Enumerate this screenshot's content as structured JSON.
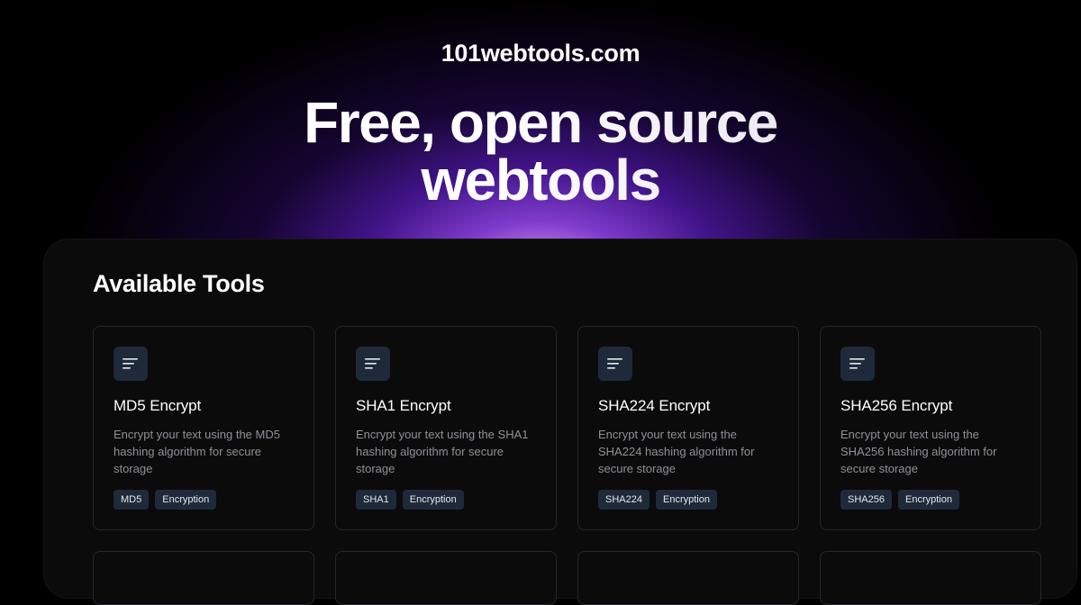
{
  "site": {
    "name": "101webtools.com"
  },
  "hero": {
    "headline_line1": "Free, open source",
    "headline_line2": "webtools"
  },
  "panel": {
    "title": "Available Tools"
  },
  "tools": [
    {
      "title": "MD5 Encrypt",
      "description": "Encrypt your text using the MD5 hashing algorithm for secure storage",
      "tags": [
        "MD5",
        "Encryption"
      ],
      "icon": "text-lines-icon"
    },
    {
      "title": "SHA1 Encrypt",
      "description": "Encrypt your text using the SHA1 hashing algorithm for secure storage",
      "tags": [
        "SHA1",
        "Encryption"
      ],
      "icon": "text-lines-icon"
    },
    {
      "title": "SHA224 Encrypt",
      "description": "Encrypt your text using the SHA224 hashing algorithm for secure storage",
      "tags": [
        "SHA224",
        "Encryption"
      ],
      "icon": "text-lines-icon"
    },
    {
      "title": "SHA256 Encrypt",
      "description": "Encrypt your text using the SHA256 hashing algorithm for secure storage",
      "tags": [
        "SHA256",
        "Encryption"
      ],
      "icon": "text-lines-icon"
    }
  ],
  "colors": {
    "accent": "#7c3aed",
    "card_border": "#26272b",
    "tag_bg": "#1e2a3a",
    "muted_text": "#8e9196"
  }
}
